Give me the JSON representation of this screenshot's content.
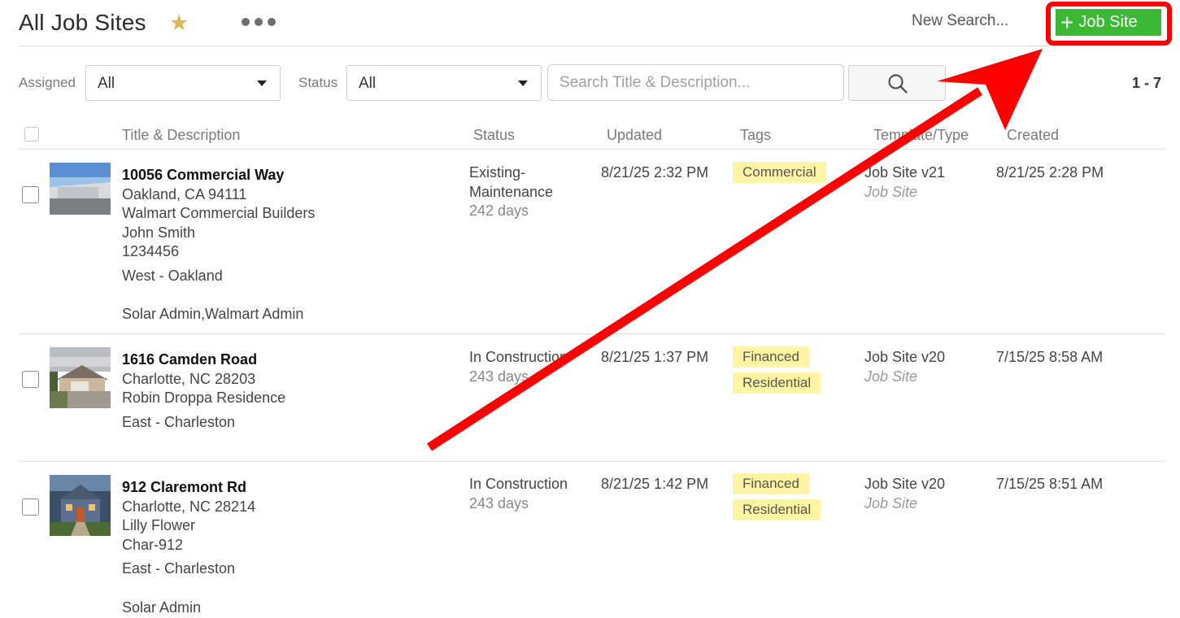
{
  "header": {
    "title": "All Job Sites",
    "new_search_label": "New Search...",
    "add_button_label": "Job Site"
  },
  "filters": {
    "assigned_label": "Assigned",
    "assigned_value": "All",
    "status_label": "Status",
    "status_value": "All",
    "search_placeholder": "Search Title & Description...",
    "result_count": "1 - 7"
  },
  "columns": {
    "title_desc": "Title & Description",
    "status": "Status",
    "updated": "Updated",
    "tags": "Tags",
    "template_type": "Template/Type",
    "created": "Created"
  },
  "rows": [
    {
      "title": "10056 Commercial Way",
      "address": "Oakland, CA 94111",
      "line3": "Walmart Commercial Builders",
      "line4": "John Smith",
      "line5": "1234456",
      "region": "West - Oakland",
      "assignees": "Solar Admin,Walmart Admin",
      "status_line1": "Existing-",
      "status_line2": "Maintenance",
      "days": "242 days",
      "updated": "8/21/25 2:32 PM",
      "tags": [
        "Commercial"
      ],
      "template": "Job Site v21",
      "type": "Job Site",
      "created": "8/21/25 2:28 PM"
    },
    {
      "title": "1616 Camden Road",
      "address": "Charlotte, NC 28203",
      "line3": "Robin Droppa Residence",
      "region": "East - Charleston",
      "status_line1": "In Construction",
      "days": "243 days",
      "updated": "8/21/25 1:37 PM",
      "tags": [
        "Financed",
        "Residential"
      ],
      "template": "Job Site v20",
      "type": "Job Site",
      "created": "7/15/25 8:58 AM"
    },
    {
      "title": "912 Claremont Rd",
      "address": "Charlotte, NC 28214",
      "line3": "Lilly Flower",
      "line4": "Char-912",
      "region": "East - Charleston",
      "assignees": "Solar Admin",
      "status_line1": "In Construction",
      "days": "243 days",
      "updated": "8/21/25 1:42 PM",
      "tags": [
        "Financed",
        "Residential"
      ],
      "template": "Job Site v20",
      "type": "Job Site",
      "created": "7/15/25 8:51 AM"
    }
  ],
  "colors": {
    "accent_green": "#3cb934",
    "annotation_red": "#ff0000",
    "star": "#e0b454",
    "tag_bg": "#fff4a3"
  },
  "icons": [
    "star-icon",
    "more-icon",
    "plus-icon",
    "chevron-down-icon",
    "search-icon",
    "arrow-annotation"
  ]
}
